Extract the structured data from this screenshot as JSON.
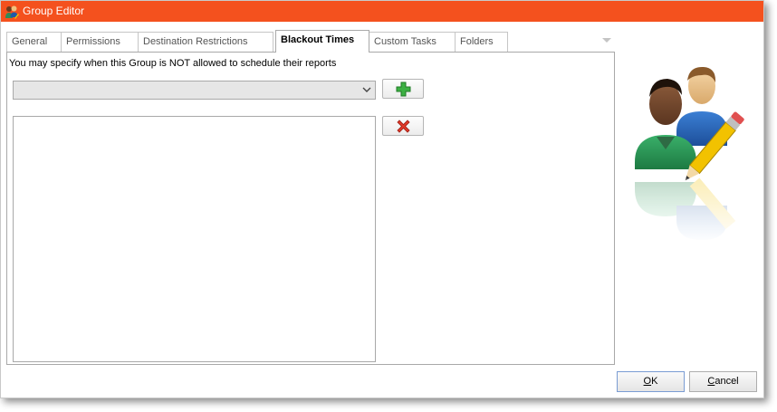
{
  "window": {
    "title": "Group Editor",
    "icon": "group-editor-icon",
    "titlebar_color": "#f4511e"
  },
  "tabs": [
    {
      "label": "General",
      "active": false
    },
    {
      "label": "Permissions",
      "active": false
    },
    {
      "label": "Destination Restrictions",
      "active": false
    },
    {
      "label": "Blackout Times",
      "active": true
    },
    {
      "label": "Custom Tasks",
      "active": false
    },
    {
      "label": "Folders",
      "active": false
    }
  ],
  "blackout": {
    "info_text": "You may specify when this Group is NOT allowed to schedule their reports",
    "schedule_select_value": "",
    "add_icon": "plus-icon",
    "remove_icon": "delete-x-icon",
    "entries": []
  },
  "footer": {
    "ok_mnemonic": "O",
    "ok_rest": "K",
    "cancel_mnemonic": "C",
    "cancel_rest": "ancel"
  },
  "illustration": "users-edit-illustration"
}
